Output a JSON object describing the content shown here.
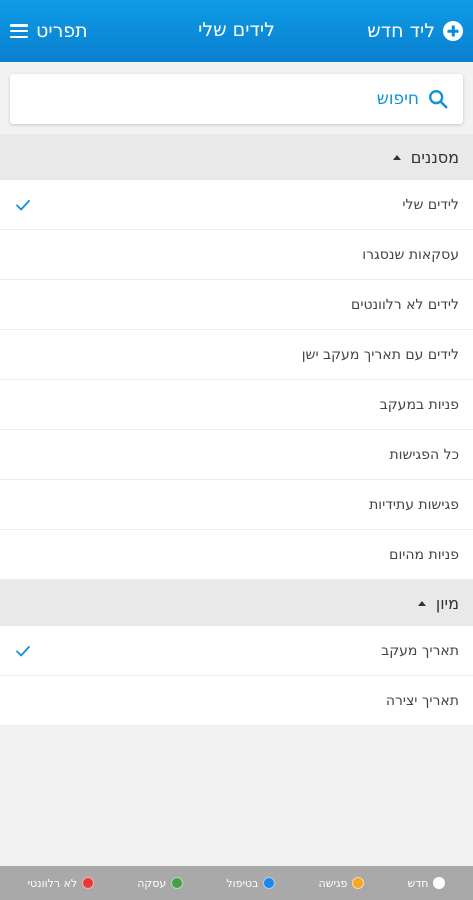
{
  "header": {
    "new_lead_label": "ליד חדש",
    "title": "לידים שלי",
    "menu_label": "תפריט"
  },
  "search": {
    "placeholder": "חיפוש"
  },
  "filters": {
    "title": "מסננים",
    "items": [
      {
        "label": "לידים שלי",
        "checked": true
      },
      {
        "label": "עסקאות שנסגרו",
        "checked": false
      },
      {
        "label": "לידים לא רלוונטים",
        "checked": false
      },
      {
        "label": "לידים עם תאריך מעקב ישן",
        "checked": false
      },
      {
        "label": "פניות במעקב",
        "checked": false
      },
      {
        "label": "כל הפגישות",
        "checked": false
      },
      {
        "label": "פגישות עתידיות",
        "checked": false
      },
      {
        "label": "פניות מהיום",
        "checked": false
      }
    ]
  },
  "sort": {
    "title": "מיון",
    "items": [
      {
        "label": "תאריך מעקב",
        "checked": true
      },
      {
        "label": "תאריך יצירה",
        "checked": false
      }
    ]
  },
  "legend": [
    {
      "label": "חדש",
      "color": "#ffffff"
    },
    {
      "label": "פגישה",
      "color": "#f5a623"
    },
    {
      "label": "בטיפול",
      "color": "#1e88e5"
    },
    {
      "label": "עסקה",
      "color": "#43a047"
    },
    {
      "label": "לא רלוונטי",
      "color": "#e53935"
    }
  ],
  "colors": {
    "accent": "#0a8bd8",
    "check": "#1591d6"
  }
}
